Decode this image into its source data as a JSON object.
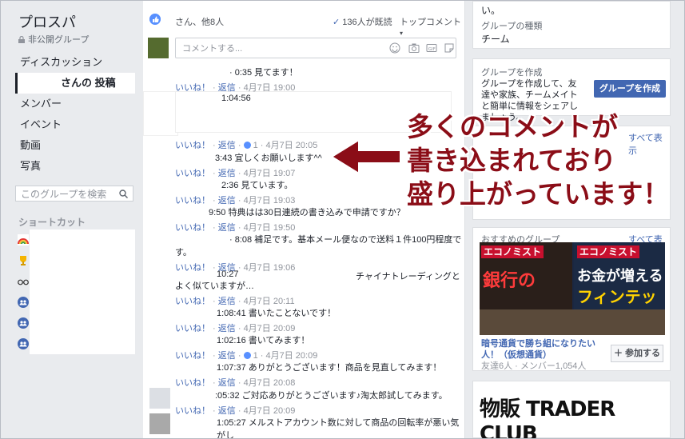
{
  "sidebar": {
    "group_name": "プロスパ",
    "privacy": "非公開グループ",
    "nav": [
      "ディスカッション",
      "さんの 投稿",
      "メンバー",
      "イベント",
      "動画",
      "写真"
    ],
    "search_placeholder": "このグループを検索",
    "shortcuts_label": "ショートカット"
  },
  "feed": {
    "liked_by": "さん、他8人",
    "read_count": "136人が既読",
    "top_comments": "トップコメント",
    "composer_placeholder": "コメントする...",
    "like": "いいね！",
    "reply": "返信",
    "comments": [
      {
        "text": "· 0:35 見てます！",
        "meta": "4月7日 19:00"
      },
      {
        "text": "1:04:56",
        "meta": "1 · 4月7日 20:05"
      },
      {
        "text": "3:43 宜しくお願いします^^",
        "meta": "4月7日 19:07"
      },
      {
        "text": "2:36 見ています。",
        "meta": "4月7日 19:03"
      },
      {
        "text": "9:50 特典はは30日連続の書き込みで申請ですか？",
        "meta": "4月7日 19:50"
      },
      {
        "text": "· 8:08 補足です。基本メール便なので送料１件100円程度で",
        "text2": "す。",
        "meta": "4月7日 19:06"
      },
      {
        "text": "10:27",
        "text_r": "チャイナトレーディングと",
        "text2": "よく似ていますが…",
        "meta": "4月7日 20:11"
      },
      {
        "text": "1:08:41 書いたことないです！",
        "meta": "4月7日 20:09"
      },
      {
        "text": "1:02:16 書いてみます！",
        "meta": "1 · 4月7日 20:09"
      },
      {
        "text": "1:07:37 ありがとうございます！商品を見直してみます！",
        "meta": "4月7日 20:08"
      },
      {
        "text": ":05:32 ご対応ありがとうございます♪淘太郎試してみます。",
        "meta": "4月7日 20:09"
      },
      {
        "text": "1:05:27 メルストアカウント数に対して商品の回転率が悪い気がし",
        "meta": ""
      }
    ]
  },
  "right": {
    "top_tail": "い。",
    "group_type_label": "グループの種類",
    "group_type_value": "チーム",
    "create_label": "グループを作成",
    "create_text": "グループを作成して、友達や家族、チームメイトと簡単に情報をシェアしましょう。",
    "create_btn": "グループを作成",
    "see_all": "すべて表示",
    "rec_label": "おすすめのグループ",
    "rec_name": "暗号通貨で勝ち組になりたい人！（仮想通貨）",
    "rec_meta": "友達6人 · メンバー1,054人",
    "join_btn": "＋ 参加する",
    "econ1": "エコノミスト",
    "econ2": "エコノミスト",
    "headline1": "銀行の",
    "headline2": "お金が増える",
    "headline3": "フィンテック",
    "trader": "物販 TRADER CLUB"
  },
  "annotation": {
    "line1": "多くのコメントが",
    "line2": "書き込まれており",
    "line3": "盛り上がっています！"
  },
  "colors": {
    "accent": "#4267b2",
    "annotation": "#8b0d17"
  }
}
